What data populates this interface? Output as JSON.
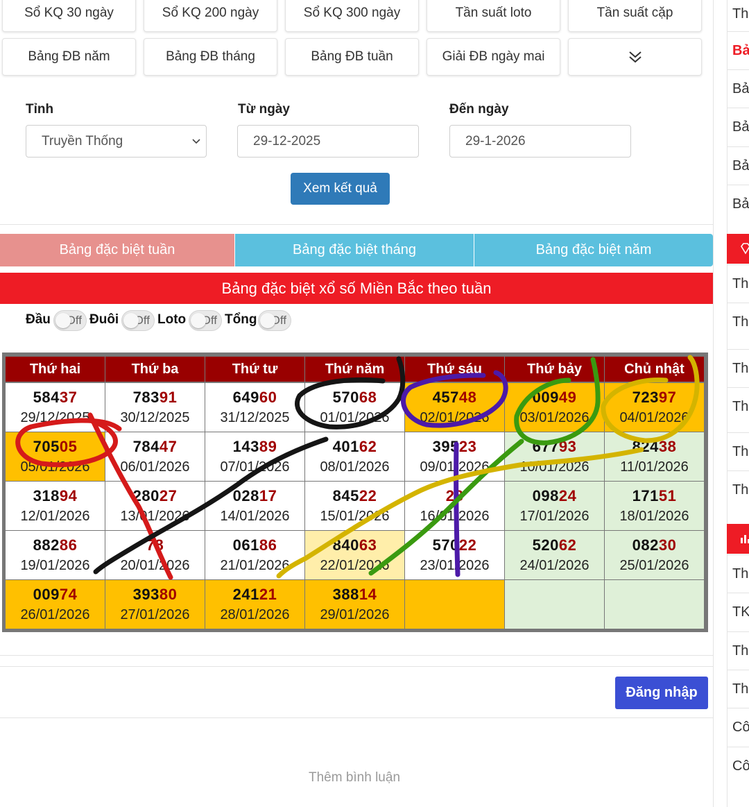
{
  "nav": {
    "row1": [
      "Sổ KQ 30 ngày",
      "Sổ KQ 200 ngày",
      "Sổ KQ 300 ngày",
      "Tần suất loto",
      "Tần suất cặp"
    ],
    "row2": [
      "Bảng ĐB năm",
      "Bảng ĐB tháng",
      "Bảng ĐB tuần",
      "Giải ĐB ngày mai"
    ],
    "more_icon": "chevron-double-down-icon"
  },
  "form": {
    "province_label": "Tỉnh",
    "province_value": "Truyền Thống",
    "from_label": "Từ ngày",
    "from_value": "29-12-2025",
    "to_label": "Đến ngày",
    "to_value": "29-1-2026",
    "submit": "Xem kết quả"
  },
  "tabs": [
    "Bảng đặc biệt tuần",
    "Bảng đặc biệt tháng",
    "Bảng đặc biệt năm"
  ],
  "banner": "Bảng đặc biệt xổ số Miền Bắc theo tuần",
  "toggles": [
    {
      "label": "Đầu",
      "state": "Off"
    },
    {
      "label": "Đuôi",
      "state": "Off"
    },
    {
      "label": "Loto",
      "state": "Off"
    },
    {
      "label": "Tổng",
      "state": "Off"
    }
  ],
  "table": {
    "headers": [
      "Thứ hai",
      "Thứ ba",
      "Thứ tư",
      "Thứ năm",
      "Thứ sáu",
      "Thứ bảy",
      "Chủ nhật"
    ],
    "rows": [
      [
        {
          "head": "584",
          "tail": "37",
          "date": "29/12/2025"
        },
        {
          "head": "783",
          "tail": "91",
          "date": "30/12/2025"
        },
        {
          "head": "649",
          "tail": "60",
          "date": "31/12/2025"
        },
        {
          "head": "570",
          "tail": "68",
          "date": "01/01/2026"
        },
        {
          "head": "457",
          "tail": "48",
          "date": "02/01/2026"
        },
        {
          "head": "009",
          "tail": "49",
          "date": "03/01/2026"
        },
        {
          "head": "723",
          "tail": "97",
          "date": "04/01/2026"
        }
      ],
      [
        {
          "head": "705",
          "tail": "05",
          "date": "05/01/2026"
        },
        {
          "head": "784",
          "tail": "47",
          "date": "06/01/2026"
        },
        {
          "head": "143",
          "tail": "89",
          "date": "07/01/2026"
        },
        {
          "head": "401",
          "tail": "62",
          "date": "08/01/2026"
        },
        {
          "head": "395",
          "tail": "23",
          "date": "09/01/2026"
        },
        {
          "head": "677",
          "tail": "93",
          "date": "10/01/2026"
        },
        {
          "head": "824",
          "tail": "38",
          "date": "11/01/2026"
        }
      ],
      [
        {
          "head": "318",
          "tail": "94",
          "date": "12/01/2026"
        },
        {
          "head": "280",
          "tail": "27",
          "date": "13/01/2026"
        },
        {
          "head": "028",
          "tail": "17",
          "date": "14/01/2026"
        },
        {
          "head": "845",
          "tail": "22",
          "date": "15/01/2026"
        },
        {
          "head": "",
          "tail": "28",
          "date": "16/01/2026"
        },
        {
          "head": "098",
          "tail": "24",
          "date": "17/01/2026"
        },
        {
          "head": "171",
          "tail": "51",
          "date": "18/01/2026"
        }
      ],
      [
        {
          "head": "882",
          "tail": "86",
          "date": "19/01/2026"
        },
        {
          "head": "",
          "tail": "78",
          "date": "20/01/2026"
        },
        {
          "head": "061",
          "tail": "86",
          "date": "21/01/2026"
        },
        {
          "head": "840",
          "tail": "63",
          "date": "22/01/2026"
        },
        {
          "head": "570",
          "tail": "22",
          "date": "23/01/2026"
        },
        {
          "head": "520",
          "tail": "62",
          "date": "24/01/2026"
        },
        {
          "head": "082",
          "tail": "30",
          "date": "25/01/2026"
        }
      ],
      [
        {
          "head": "009",
          "tail": "74",
          "date": "26/01/2026"
        },
        {
          "head": "393",
          "tail": "80",
          "date": "27/01/2026"
        },
        {
          "head": "241",
          "tail": "21",
          "date": "28/01/2026"
        },
        {
          "head": "388",
          "tail": "14",
          "date": "29/01/2026"
        },
        {
          "head": "",
          "tail": "",
          "date": ""
        },
        {
          "head": "",
          "tail": "",
          "date": ""
        },
        {
          "head": "",
          "tail": "",
          "date": ""
        }
      ]
    ],
    "cell_colors": [
      [
        "#ffffff",
        "#ffffff",
        "#ffffff",
        "#ffffff",
        "#ffc000",
        "#ffc000",
        "#ffc000"
      ],
      [
        "#ffc000",
        "#ffffff",
        "#ffffff",
        "#ffffff",
        "#ffffff",
        "#dff0d8",
        "#dff0d8"
      ],
      [
        "#ffffff",
        "#ffffff",
        "#ffffff",
        "#ffffff",
        "#ffffff",
        "#dff0d8",
        "#dff0d8"
      ],
      [
        "#ffffff",
        "#ffffff",
        "#ffffff",
        "#ffeeaa",
        "#ffffff",
        "#dff0d8",
        "#dff0d8"
      ],
      [
        "#ffc000",
        "#ffc000",
        "#ffc000",
        "#ffc000",
        "#ffc000",
        "#dff0d8",
        "#dff0d8"
      ]
    ]
  },
  "sidebar_right": {
    "items1": [
      "Th",
      "Bả",
      "Bả",
      "Bả",
      "Bả",
      "Bả"
    ],
    "items2": [
      "Th",
      "Th",
      "Th",
      "Th",
      "Th",
      "Th"
    ],
    "items3": [
      "Th",
      "TK",
      "Th",
      "Th",
      "Cô",
      "Cô"
    ]
  },
  "comments": {
    "login": "Đăng nhập",
    "placeholder": "Thêm bình luận"
  },
  "colors": {
    "tab_week": "#e7918e",
    "tab_month": "#5bc0de",
    "banner": "#ee1c25",
    "header": "#990000",
    "yellow": "#ffc000",
    "green": "#dff0d8",
    "submit": "#2f7ab8",
    "login": "#3b4fd4"
  }
}
